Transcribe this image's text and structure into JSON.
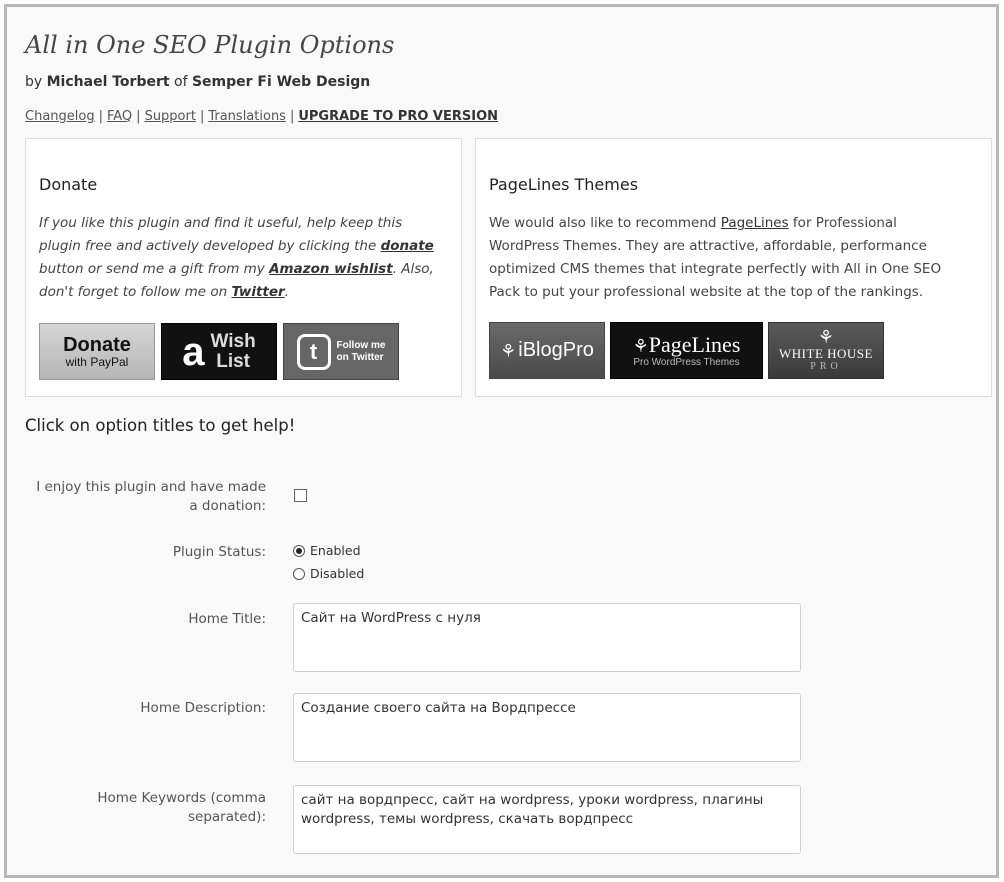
{
  "header": {
    "title": "All in One SEO Plugin Options",
    "by_prefix": "by ",
    "author": "Michael Torbert",
    "of_text": " of ",
    "company": "Semper Fi Web Design"
  },
  "links": {
    "changelog": "Changelog",
    "faq": "FAQ",
    "support": "Support",
    "translations": "Translations",
    "upgrade": "UPGRADE TO PRO VERSION",
    "separator": "|"
  },
  "donate_box": {
    "heading": "Donate",
    "text_1": "If you like this plugin and find it useful, help keep this plugin free and actively developed by clicking the ",
    "donate_link": "donate",
    "text_2": " button or send me a gift from my ",
    "wishlist_link": "Amazon wishlist",
    "text_3": ". Also, don't forget to follow me on ",
    "twitter_link": "Twitter",
    "text_4": ".",
    "buttons": {
      "donate_line1": "Donate",
      "donate_line2": "with PayPal",
      "amazon_logo": "a",
      "wish_line1": "Wish",
      "wish_line2": "List",
      "twitter_logo": "t",
      "twitter_line1": "Follow me",
      "twitter_line2": "on Twitter"
    }
  },
  "pagelines_box": {
    "heading": "PageLines Themes",
    "text_1": "We would also like to recommend ",
    "pagelines_link": "PageLines",
    "text_2": " for Professional WordPress Themes. They are attractive, affordable, performance optimized CMS themes that integrate perfectly with All in One SEO Pack to put your professional website at the top of the rankings.",
    "buttons": {
      "iblogpro": "iBlogPro",
      "pagelines_name": "PageLines",
      "pagelines_sub": "Pro WordPress Themes",
      "whitehouse_name": "WHITE HOUSE",
      "whitehouse_sub": "PRO"
    }
  },
  "help_text": "Click on option titles to get help!",
  "options": {
    "donation_label": "I enjoy this plugin and have made a donation:",
    "donation_checked": false,
    "status_label": "Plugin Status:",
    "status_enabled": "Enabled",
    "status_disabled": "Disabled",
    "status_value": "Enabled",
    "home_title_label": "Home Title:",
    "home_title_value": "Сайт на WordPress с нуля",
    "home_description_label": "Home Description:",
    "home_description_value": "Создание своего сайта на Вордпрессе",
    "home_keywords_label": "Home Keywords (comma separated):",
    "home_keywords_value": "сайт на вордпресс, сайт на wordpress, уроки wordpress, плагины wordpress, темы wordpress, скачать вордпресс"
  },
  "colors": {
    "background": "#f9f9f9",
    "border": "#b8b8b8",
    "box_background": "#ffffff"
  }
}
